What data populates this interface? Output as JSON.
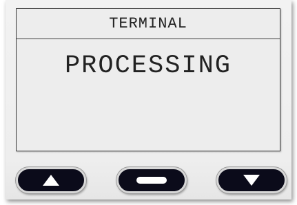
{
  "screen": {
    "header": "TERMINAL",
    "message": "PROCESSING"
  },
  "buttons": [
    {
      "icon": "up-arrow-icon"
    },
    {
      "icon": "enter-bar-icon"
    },
    {
      "icon": "down-arrow-icon"
    }
  ]
}
